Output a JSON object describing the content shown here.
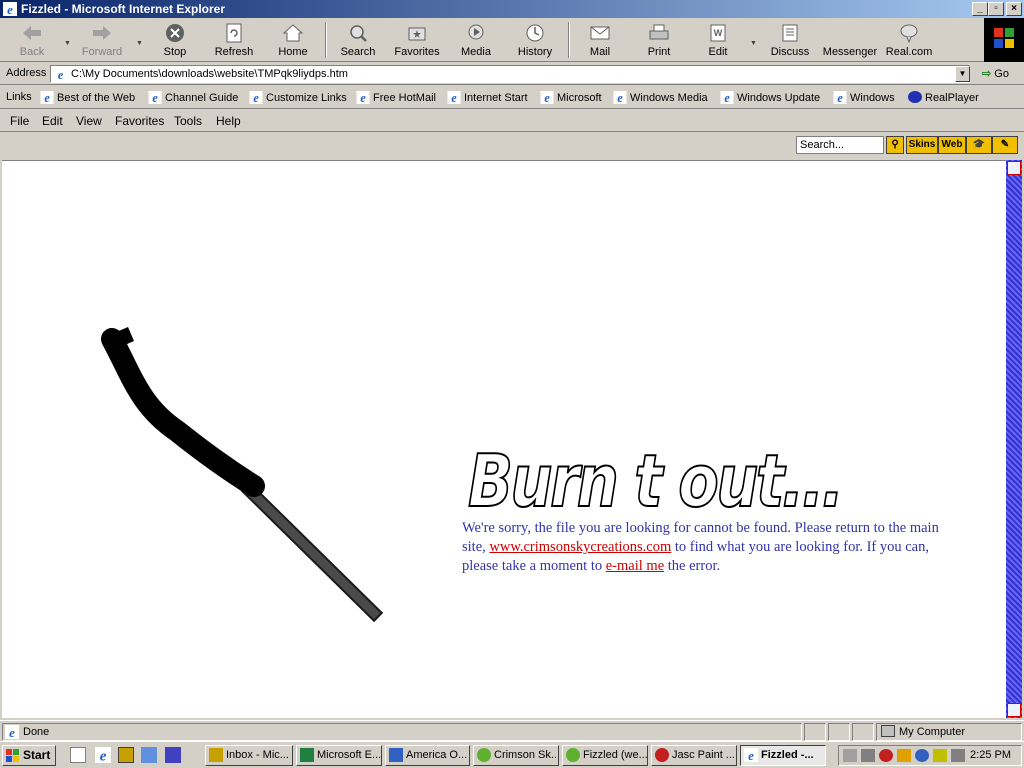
{
  "window": {
    "title": "Fizzled - Microsoft Internet Explorer"
  },
  "toolbar": {
    "back": "Back",
    "forward": "Forward",
    "stop": "Stop",
    "refresh": "Refresh",
    "home": "Home",
    "search": "Search",
    "favorites": "Favorites",
    "media": "Media",
    "history": "History",
    "mail": "Mail",
    "print": "Print",
    "edit": "Edit",
    "discuss": "Discuss",
    "messenger": "Messenger",
    "realcom": "Real.com"
  },
  "address": {
    "label": "Address",
    "value": "C:\\My Documents\\downloads\\website\\TMPqk9liydps.htm",
    "go": "Go"
  },
  "links": {
    "label": "Links",
    "items": [
      "Best of the Web",
      "Channel Guide",
      "Customize Links",
      "Free HotMail",
      "Internet Start",
      "Microsoft",
      "Windows Media",
      "Windows Update",
      "Windows",
      "RealPlayer"
    ]
  },
  "menu": [
    "File",
    "Edit",
    "View",
    "Favorites",
    "Tools",
    "Help"
  ],
  "searchbar": {
    "placeholder": "Search...",
    "skins": "Skins",
    "web": "Web"
  },
  "page": {
    "heading": "Burn t out...",
    "msg_1": "We're sorry, the file you are looking for cannot be found. Please return to the main site, ",
    "site_link": "www.crimsonskycreations.com",
    "msg_2": " to find what you are looking for. If you can, please take a moment to ",
    "email_link": "e-mail me",
    "msg_3": " the error."
  },
  "status": {
    "text": "Done",
    "zone": "My Computer"
  },
  "taskbar": {
    "start": "Start",
    "tasks": [
      "Inbox - Mic...",
      "Microsoft E...",
      "America O...",
      "Crimson Sk...",
      "Fizzled (we...",
      "Jasc Paint ...",
      "Fizzled -..."
    ],
    "clock": "2:25 PM"
  }
}
